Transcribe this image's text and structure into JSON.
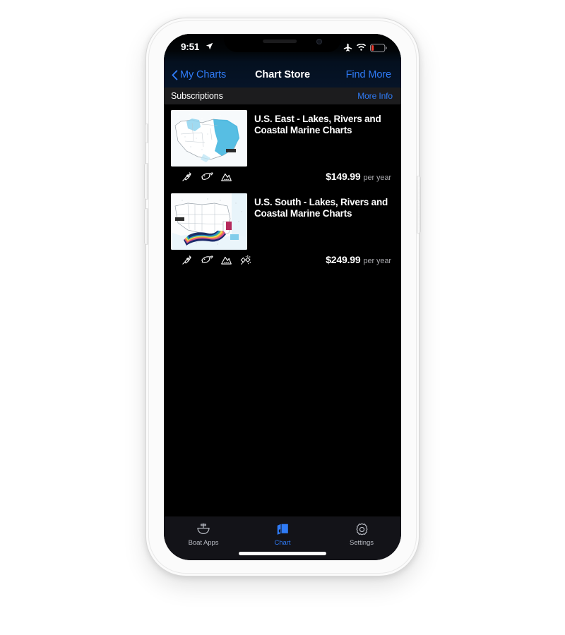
{
  "status_bar": {
    "time": "9:51",
    "location_icon": "location-arrow-icon",
    "airplane_icon": "airplane-mode-icon",
    "wifi_icon": "wifi-icon",
    "battery_icon": "battery-low-icon",
    "battery_color": "#f03b2e"
  },
  "nav_bar": {
    "back_label": "My Charts",
    "title": "Chart Store",
    "action_label": "Find More",
    "accent_color": "#2f7bf6"
  },
  "section": {
    "title": "Subscriptions",
    "more_info_label": "More Info"
  },
  "cards": [
    {
      "title": "U.S. East - Lakes, Rivers and Coastal Marine Charts",
      "price": "$149.99",
      "period": "per year",
      "thumb_name": "map-thumbnail-us-east",
      "features": [
        "boat-route-icon",
        "fish-icon",
        "sonar-chart-icon"
      ]
    },
    {
      "title": "U.S. South - Lakes, Rivers and Coastal Marine Charts",
      "price": "$249.99",
      "period": "per year",
      "thumb_name": "map-thumbnail-us-south",
      "features": [
        "boat-route-icon",
        "fish-icon",
        "sonar-chart-icon",
        "satellite-overlay-icon"
      ]
    }
  ],
  "tab_bar": {
    "items": [
      {
        "label": "Boat Apps",
        "icon": "boat-icon",
        "active": false
      },
      {
        "label": "Chart",
        "icon": "chart-map-icon",
        "active": true
      },
      {
        "label": "Settings",
        "icon": "gear-icon",
        "active": false
      }
    ],
    "active_color": "#2f7bf6",
    "inactive_color": "#b9bcc4"
  }
}
